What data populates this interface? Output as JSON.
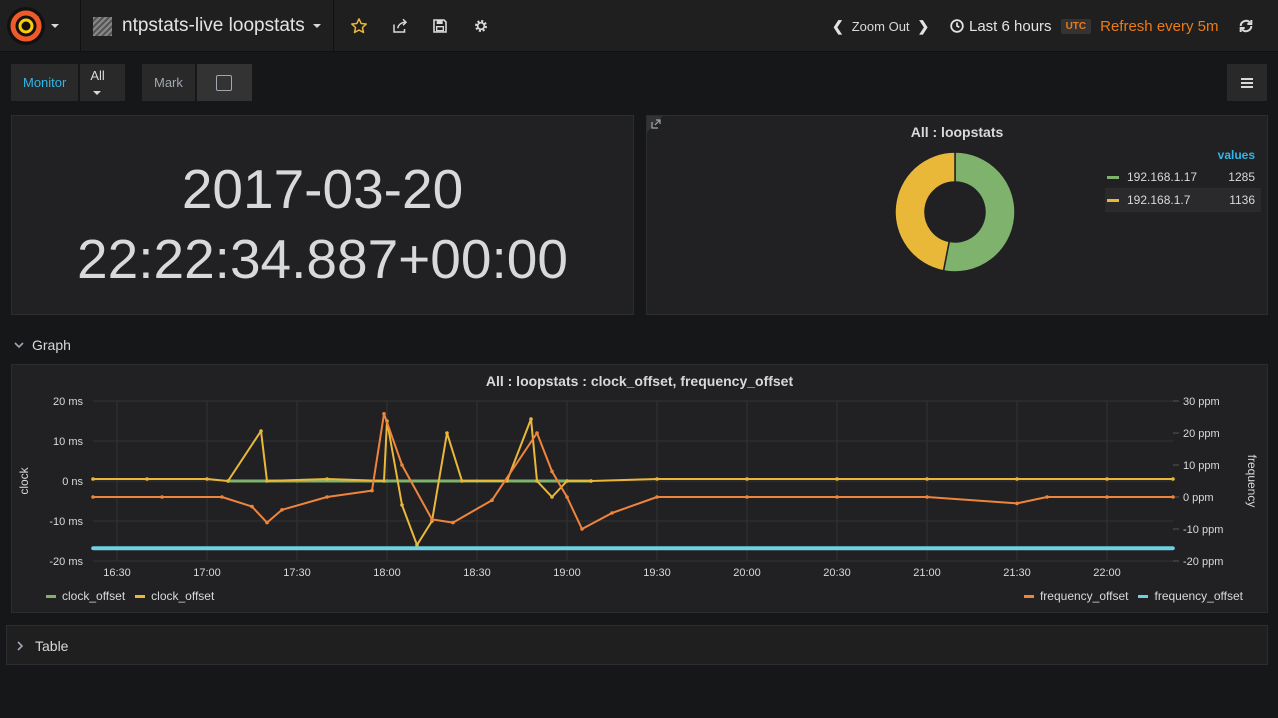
{
  "navbar": {
    "dashboard_title": "ntpstats-live loopstats",
    "zoom_out_label": "Zoom Out",
    "time_range": "Last 6 hours",
    "timezone_badge": "UTC",
    "refresh_label": "Refresh every 5m"
  },
  "submenu": {
    "monitor_label": "Monitor",
    "all_value": "All",
    "mark_label": "Mark"
  },
  "time_panel": {
    "date": "2017-03-20",
    "time": "22:22:34.887+00:00"
  },
  "pie_panel": {
    "title": "All : loopstats",
    "legend_header": "values",
    "items": [
      {
        "name": "192.168.1.17",
        "value": "1285",
        "color": "#7eb26d"
      },
      {
        "name": "192.168.1.7",
        "value": "1136",
        "color": "#eab839"
      }
    ]
  },
  "graph_row": {
    "title": "Graph"
  },
  "table_row": {
    "title": "Table"
  },
  "graph_panel": {
    "title": "All : loopstats : clock_offset, frequency_offset",
    "y_left_label": "clock",
    "y_right_label": "frequency",
    "y_left_ticks": [
      "20 ms",
      "10 ms",
      "0 ns",
      "-10 ms",
      "-20 ms"
    ],
    "y_right_ticks": [
      "30 ppm",
      "20 ppm",
      "10 ppm",
      "0 ppm",
      "-10 ppm",
      "-20 ppm"
    ],
    "x_ticks": [
      "16:30",
      "17:00",
      "17:30",
      "18:00",
      "18:30",
      "19:00",
      "19:30",
      "20:00",
      "20:30",
      "21:00",
      "21:30",
      "22:00"
    ],
    "legend_left": [
      {
        "name": "clock_offset",
        "color": "#7eb26d"
      },
      {
        "name": "clock_offset",
        "color": "#eab839"
      }
    ],
    "legend_right": [
      {
        "name": "frequency_offset",
        "color": "#ef843c"
      },
      {
        "name": "frequency_offset",
        "color": "#6ed0e0"
      }
    ]
  },
  "chart_data": {
    "type": "line",
    "title": "All : loopstats : clock_offset, frequency_offset",
    "ylabel": "clock",
    "y2label": "frequency",
    "ylim": [
      -20,
      20
    ],
    "y_unit": "ms",
    "y2lim": [
      -20,
      30
    ],
    "y2_unit": "ppm",
    "xlim": [
      "16:22",
      "22:22"
    ],
    "grid": true,
    "series": [
      {
        "name": "clock_offset",
        "axis": "left",
        "color": "#7eb26d",
        "x": [
          "17:07",
          "17:30",
          "18:00",
          "18:30",
          "19:00",
          "19:08"
        ],
        "values": [
          0,
          0,
          0,
          0,
          0,
          0
        ]
      },
      {
        "name": "clock_offset",
        "axis": "left",
        "color": "#eab839",
        "x": [
          "16:22",
          "16:40",
          "17:00",
          "17:07",
          "17:18",
          "17:20",
          "17:40",
          "17:59",
          "18:00",
          "18:05",
          "18:10",
          "18:15",
          "18:20",
          "18:25",
          "18:40",
          "18:48",
          "18:50",
          "18:55",
          "19:00",
          "19:08",
          "19:30",
          "20:00",
          "20:30",
          "21:00",
          "21:30",
          "22:00",
          "22:22"
        ],
        "values": [
          0.5,
          0.5,
          0.5,
          0,
          12.5,
          0,
          0.5,
          0,
          15,
          -6,
          -16,
          -10,
          12,
          0,
          0,
          15.5,
          0,
          -4,
          0,
          0,
          0.5,
          0.5,
          0.5,
          0.5,
          0.5,
          0.5,
          0.5
        ]
      },
      {
        "name": "frequency_offset",
        "axis": "right",
        "color": "#ef843c",
        "x": [
          "16:22",
          "16:45",
          "17:05",
          "17:15",
          "17:20",
          "17:25",
          "17:40",
          "17:55",
          "17:59",
          "18:05",
          "18:15",
          "18:22",
          "18:35",
          "18:50",
          "18:55",
          "19:00",
          "19:05",
          "19:15",
          "19:30",
          "20:00",
          "20:30",
          "21:00",
          "21:30",
          "21:40",
          "22:00",
          "22:22"
        ],
        "values": [
          0,
          0,
          0,
          -3,
          -8,
          -4,
          0,
          2,
          26,
          10,
          -7,
          -8,
          -1,
          20,
          8,
          0,
          -10,
          -5,
          0,
          0,
          0,
          0,
          -2,
          0,
          0,
          0
        ]
      },
      {
        "name": "frequency_offset",
        "axis": "right",
        "color": "#6ed0e0",
        "x": [
          "16:22",
          "17:00",
          "18:00",
          "19:00",
          "20:00",
          "21:00",
          "22:00",
          "22:22"
        ],
        "values": [
          -16,
          -16,
          -16,
          -16,
          -16,
          -16,
          -16,
          -16
        ]
      }
    ]
  }
}
